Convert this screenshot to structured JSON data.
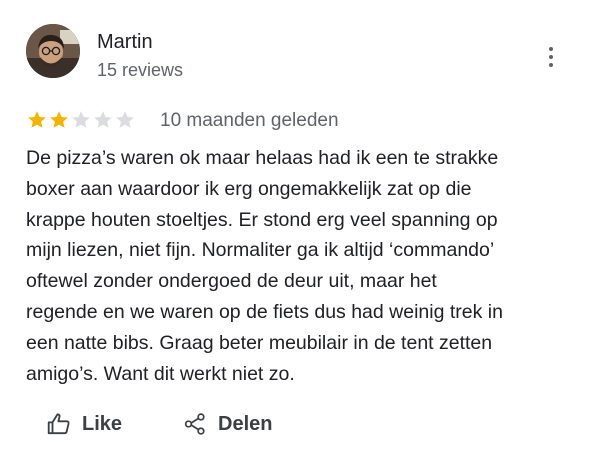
{
  "review": {
    "author": {
      "name": "Martin",
      "meta": "15 reviews"
    },
    "rating": 2,
    "rating_max": 5,
    "date": "10 maanden geleden",
    "text": "De pizza’s waren ok maar helaas had ik een te strakke\nboxer aan waardoor ik erg ongemakkelijk zat op die\nkrappe houten stoeltjes. Er stond erg veel spanning op\nmijn liezen, niet fijn. Normaliter ga ik altijd ‘commando’\noftewel zonder ondergoed de deur uit, maar het\nregende en we waren op de fiets dus had weinig trek in\neen natte bibs. Graag beter meubilair in de tent zetten\namigo’s. Want dit werkt niet zo."
  },
  "actions": {
    "like_label": "Like",
    "share_label": "Delen"
  },
  "icons": {
    "more": "more-vert-icon",
    "like": "thumb-up-icon",
    "share": "share-icon",
    "star": "star-icon"
  },
  "colors": {
    "star_filled": "#F4B400",
    "star_empty": "#DADCE0",
    "text_primary": "#202124",
    "text_secondary": "#5F6368"
  }
}
